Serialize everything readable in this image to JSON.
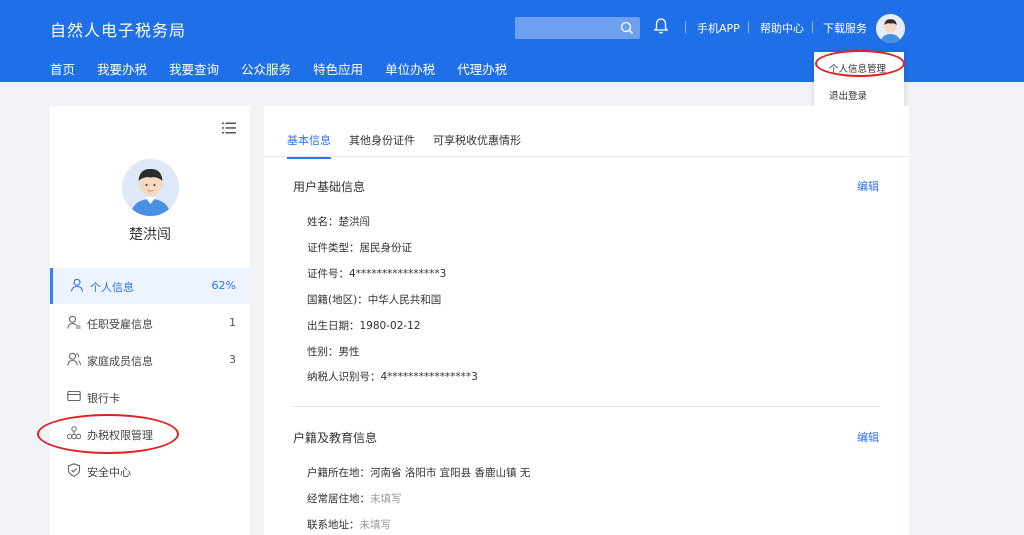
{
  "header": {
    "brand": "自然人电子税务局",
    "nav": [
      "首页",
      "我要办税",
      "我要查询",
      "公众服务",
      "特色应用",
      "单位办税",
      "代理办税"
    ],
    "search": {
      "placeholder": ""
    },
    "links": {
      "mobile": "手机APP",
      "help": "帮助中心",
      "download": "下载服务"
    },
    "colors": {
      "primary": "#1f6fe9",
      "accent": "#2f74ec",
      "annotation": "#e02020"
    }
  },
  "dropdown": {
    "items": [
      "个人信息管理",
      "退出登录"
    ]
  },
  "profile": {
    "name": "楚洪闯"
  },
  "sidebar": {
    "items": [
      {
        "label": "个人信息",
        "count": "62%",
        "icon": "user-icon"
      },
      {
        "label": "任职受雇信息",
        "count": "1",
        "icon": "user-list-icon"
      },
      {
        "label": "家庭成员信息",
        "count": "3",
        "icon": "users-icon"
      },
      {
        "label": "银行卡",
        "count": "",
        "icon": "card-icon"
      },
      {
        "label": "办税权限管理",
        "count": "",
        "icon": "org-chart-icon"
      },
      {
        "label": "安全中心",
        "count": "",
        "icon": "shield-icon"
      }
    ]
  },
  "tabs": [
    "基本信息",
    "其他身份证件",
    "可享税收优惠情形"
  ],
  "basic_info": {
    "title": "用户基础信息",
    "edit": "编辑",
    "fields": [
      {
        "label": "姓名：",
        "value": "楚洪闯"
      },
      {
        "label": "证件类型：",
        "value": "居民身份证"
      },
      {
        "label": "证件号：",
        "value": "4****************3"
      },
      {
        "label": "国籍(地区)：",
        "value": "中华人民共和国"
      },
      {
        "label": "出生日期：",
        "value": "1980-02-12"
      },
      {
        "label": "性别：",
        "value": "男性"
      },
      {
        "label": "纳税人识别号：",
        "value": "4****************3"
      }
    ]
  },
  "household_info": {
    "title": "户籍及教育信息",
    "edit": "编辑",
    "fields": [
      {
        "label": "户籍所在地：",
        "value": "河南省 洛阳市 宜阳县 香鹿山镇 无",
        "muted": false
      },
      {
        "label": "经常居住地：",
        "value": "未填写",
        "muted": true
      },
      {
        "label": "联系地址：",
        "value": "未填写",
        "muted": true
      }
    ]
  }
}
